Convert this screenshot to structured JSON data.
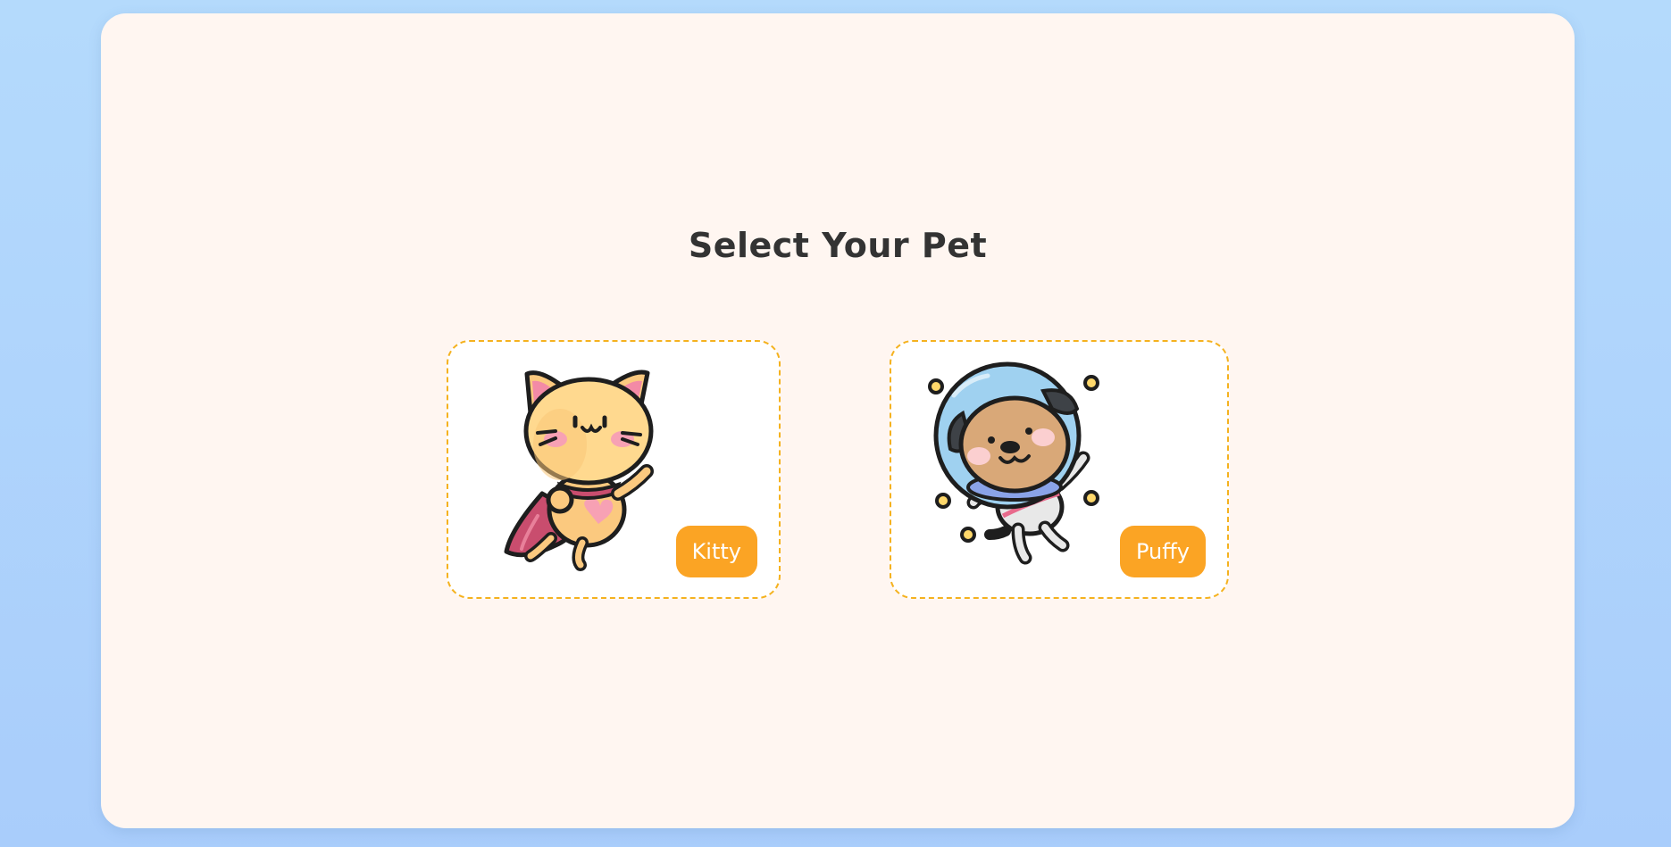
{
  "page": {
    "title": "Select Your Pet"
  },
  "pets": [
    {
      "name": "Kitty",
      "icon": "superhero-cat-icon",
      "accent": "#fba424"
    },
    {
      "name": "Puffy",
      "icon": "astronaut-dog-icon",
      "accent": "#fba424"
    }
  ],
  "colors": {
    "background": "#b4dafc",
    "panel": "#fff6f1",
    "card_border": "#f5b21f",
    "button": "#fba424",
    "title": "#333333"
  }
}
